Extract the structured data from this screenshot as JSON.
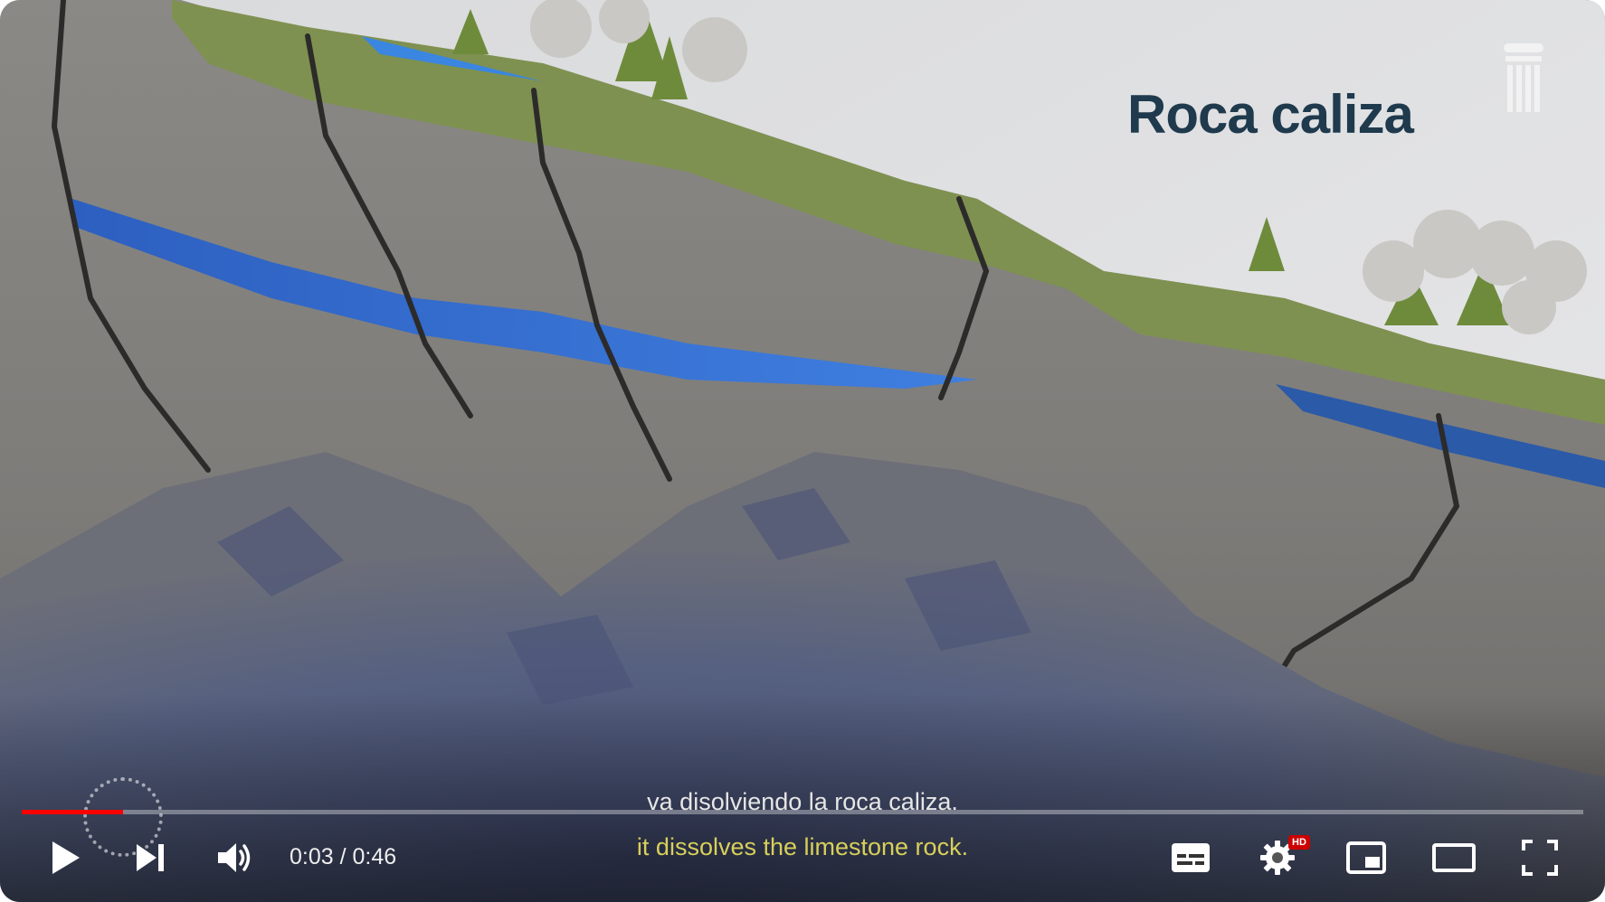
{
  "video": {
    "title_overlay": "Roca caliza",
    "captions": {
      "primary": "va disolviendo la roca caliza.",
      "secondary": "it dissolves the limestone rock."
    }
  },
  "player": {
    "current_time": "0:03",
    "separator": "/",
    "duration": "0:46",
    "progress_fraction": 0.065,
    "hd_badge": "HD",
    "accent_color": "#ff0000",
    "caption_secondary_color": "#d8cf5a",
    "title_color": "#1f3a4d"
  },
  "controls": {
    "play": "play-icon",
    "next": "next-icon",
    "volume": "volume-icon",
    "subtitles": "subtitles-icon",
    "settings": "gear-icon",
    "miniplayer": "miniplayer-icon",
    "theater": "theater-mode-icon",
    "fullscreen": "fullscreen-icon"
  }
}
